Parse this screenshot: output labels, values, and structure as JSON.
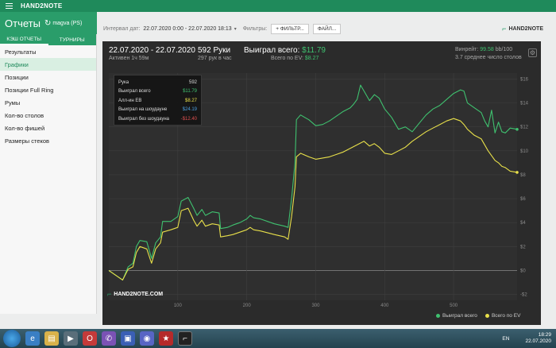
{
  "app": {
    "name": "HAND2NOTE"
  },
  "header": {
    "title": "Отчеты",
    "player": "magva (PS)"
  },
  "sidebar": {
    "tabs": [
      {
        "label": "КЭШ ОТЧЕТЫ"
      },
      {
        "label": "ТУРНИРЫ"
      }
    ],
    "items": [
      {
        "label": "Результаты"
      },
      {
        "label": "Графики"
      },
      {
        "label": "Позиции"
      },
      {
        "label": "Позиции Full Ring"
      },
      {
        "label": "Румы"
      },
      {
        "label": "Кол-во столов"
      },
      {
        "label": "Кол-во фишей"
      },
      {
        "label": "Размеры стеков"
      }
    ]
  },
  "toolbar": {
    "interval_label": "Интервал дат:",
    "interval_value": "22.07.2020 0:00 - 22.07.2020 18:13",
    "filters_label": "Фильтры:",
    "filters_button": "ФИЛЬТР...",
    "file_button": "ФАЙЛ...",
    "logo": "HAND2NOTE"
  },
  "summary": {
    "date_range": "22.07.2020 - 22.07.2020",
    "active": "Активен 1ч 59м",
    "hands": "592 Руки",
    "hands_rate": "297 рук в час",
    "won_label": "Выиграл всего:",
    "won_value": "$11.79",
    "ev_label": "Всего по EV:",
    "ev_value": "$8.27",
    "winrate_label": "Винрейт:",
    "winrate_value": "99.58",
    "winrate_unit": "bb/100",
    "tables": "3.7 среднее число столов"
  },
  "tooltip": {
    "rows": [
      {
        "label": "Рука",
        "value": "592",
        "color": "#dddddd"
      },
      {
        "label": "Выиграл всего",
        "value": "$11.79",
        "color": "#3fc16f"
      },
      {
        "label": "Алл-ин EB",
        "value": "$8.27",
        "color": "#e8e04a"
      },
      {
        "label": "Выиграл на шоудауне",
        "value": "$24.19",
        "color": "#4a9fe0"
      },
      {
        "label": "Выиграл без шоудауна",
        "value": "-$12.40",
        "color": "#e05050"
      }
    ]
  },
  "chart_data": {
    "type": "line",
    "x_ticks": [
      100,
      200,
      300,
      400,
      500
    ],
    "y_ticks": [
      "$16",
      "$14",
      "$12",
      "$10",
      "$8",
      "$6",
      "$4",
      "$2",
      "$0",
      "-$2"
    ],
    "xlim": [
      0,
      592
    ],
    "ylim": [
      -2.5,
      16.5
    ],
    "series": [
      {
        "name": "Выиграл всего",
        "color": "#3fc16f",
        "points": [
          [
            0,
            0
          ],
          [
            10,
            -0.4
          ],
          [
            20,
            -0.8
          ],
          [
            28,
            0.3
          ],
          [
            35,
            0.6
          ],
          [
            40,
            2.0
          ],
          [
            45,
            2.5
          ],
          [
            55,
            2.4
          ],
          [
            62,
            1.0
          ],
          [
            68,
            2.3
          ],
          [
            75,
            2.8
          ],
          [
            78,
            4.1
          ],
          [
            90,
            4.1
          ],
          [
            100,
            4.5
          ],
          [
            105,
            5.8
          ],
          [
            115,
            6.1
          ],
          [
            123,
            5.2
          ],
          [
            128,
            4.6
          ],
          [
            135,
            5.1
          ],
          [
            140,
            4.6
          ],
          [
            150,
            4.9
          ],
          [
            160,
            4.8
          ],
          [
            162,
            3.5
          ],
          [
            172,
            3.6
          ],
          [
            180,
            3.8
          ],
          [
            190,
            4.0
          ],
          [
            200,
            4.3
          ],
          [
            205,
            4.6
          ],
          [
            210,
            4.4
          ],
          [
            220,
            4.3
          ],
          [
            240,
            3.9
          ],
          [
            255,
            3.7
          ],
          [
            260,
            3.6
          ],
          [
            265,
            6.0
          ],
          [
            270,
            9.0
          ],
          [
            272,
            12.6
          ],
          [
            278,
            13.0
          ],
          [
            290,
            12.6
          ],
          [
            300,
            12.1
          ],
          [
            310,
            12.2
          ],
          [
            320,
            12.5
          ],
          [
            330,
            12.9
          ],
          [
            340,
            13.3
          ],
          [
            350,
            13.6
          ],
          [
            355,
            13.9
          ],
          [
            360,
            14.3
          ],
          [
            365,
            15.5
          ],
          [
            370,
            15.0
          ],
          [
            378,
            14.2
          ],
          [
            385,
            14.7
          ],
          [
            392,
            14.4
          ],
          [
            400,
            13.5
          ],
          [
            410,
            12.8
          ],
          [
            420,
            11.8
          ],
          [
            430,
            12.0
          ],
          [
            440,
            11.6
          ],
          [
            450,
            12.3
          ],
          [
            460,
            13.0
          ],
          [
            470,
            13.5
          ],
          [
            480,
            13.8
          ],
          [
            490,
            14.3
          ],
          [
            500,
            14.8
          ],
          [
            510,
            15.1
          ],
          [
            515,
            15.0
          ],
          [
            520,
            14.0
          ],
          [
            530,
            13.6
          ],
          [
            540,
            13.2
          ],
          [
            545,
            12.5
          ],
          [
            550,
            12.0
          ],
          [
            555,
            13.4
          ],
          [
            560,
            11.5
          ],
          [
            565,
            12.4
          ],
          [
            570,
            11.6
          ],
          [
            575,
            11.5
          ],
          [
            582,
            11.9
          ],
          [
            592,
            11.8
          ]
        ]
      },
      {
        "name": "Всего по EV",
        "color": "#e8e04a",
        "points": [
          [
            0,
            0
          ],
          [
            10,
            -0.4
          ],
          [
            20,
            -0.8
          ],
          [
            28,
            0.1
          ],
          [
            35,
            0.3
          ],
          [
            40,
            1.5
          ],
          [
            45,
            2.0
          ],
          [
            55,
            1.8
          ],
          [
            62,
            0.6
          ],
          [
            68,
            1.8
          ],
          [
            75,
            2.3
          ],
          [
            78,
            3.2
          ],
          [
            90,
            3.4
          ],
          [
            100,
            3.6
          ],
          [
            105,
            5.0
          ],
          [
            115,
            5.2
          ],
          [
            123,
            4.2
          ],
          [
            128,
            3.7
          ],
          [
            135,
            4.2
          ],
          [
            140,
            3.7
          ],
          [
            150,
            3.9
          ],
          [
            160,
            3.8
          ],
          [
            162,
            2.8
          ],
          [
            172,
            2.9
          ],
          [
            180,
            3.0
          ],
          [
            190,
            3.2
          ],
          [
            200,
            3.4
          ],
          [
            205,
            3.6
          ],
          [
            210,
            3.4
          ],
          [
            220,
            3.3
          ],
          [
            240,
            3.0
          ],
          [
            255,
            2.8
          ],
          [
            260,
            2.6
          ],
          [
            265,
            4.5
          ],
          [
            270,
            7.0
          ],
          [
            272,
            9.5
          ],
          [
            278,
            9.8
          ],
          [
            290,
            9.5
          ],
          [
            300,
            9.3
          ],
          [
            310,
            9.4
          ],
          [
            320,
            9.5
          ],
          [
            330,
            9.7
          ],
          [
            340,
            9.9
          ],
          [
            350,
            10.2
          ],
          [
            360,
            10.5
          ],
          [
            370,
            10.8
          ],
          [
            378,
            10.4
          ],
          [
            385,
            10.6
          ],
          [
            392,
            10.3
          ],
          [
            400,
            9.8
          ],
          [
            410,
            9.7
          ],
          [
            420,
            10.0
          ],
          [
            430,
            10.3
          ],
          [
            440,
            10.8
          ],
          [
            450,
            11.2
          ],
          [
            460,
            11.6
          ],
          [
            470,
            11.9
          ],
          [
            480,
            12.2
          ],
          [
            490,
            12.5
          ],
          [
            500,
            12.7
          ],
          [
            510,
            12.5
          ],
          [
            515,
            12.2
          ],
          [
            520,
            11.8
          ],
          [
            530,
            11.3
          ],
          [
            540,
            11.0
          ],
          [
            545,
            10.5
          ],
          [
            550,
            10.0
          ],
          [
            555,
            9.6
          ],
          [
            560,
            9.2
          ],
          [
            565,
            9.0
          ],
          [
            570,
            8.7
          ],
          [
            575,
            8.6
          ],
          [
            582,
            8.3
          ],
          [
            592,
            8.2
          ]
        ]
      }
    ],
    "grid": true,
    "legend": "bottom-right"
  },
  "watermark": "HAND2NOTE.COM",
  "taskbar": {
    "lang": "EN",
    "time": "18:29",
    "date": "22.07.2020"
  },
  "colors": {
    "accent": "#2a9d6a",
    "panel": "#2b2b2b",
    "won": "#3fc16f",
    "ev": "#e8e04a"
  }
}
